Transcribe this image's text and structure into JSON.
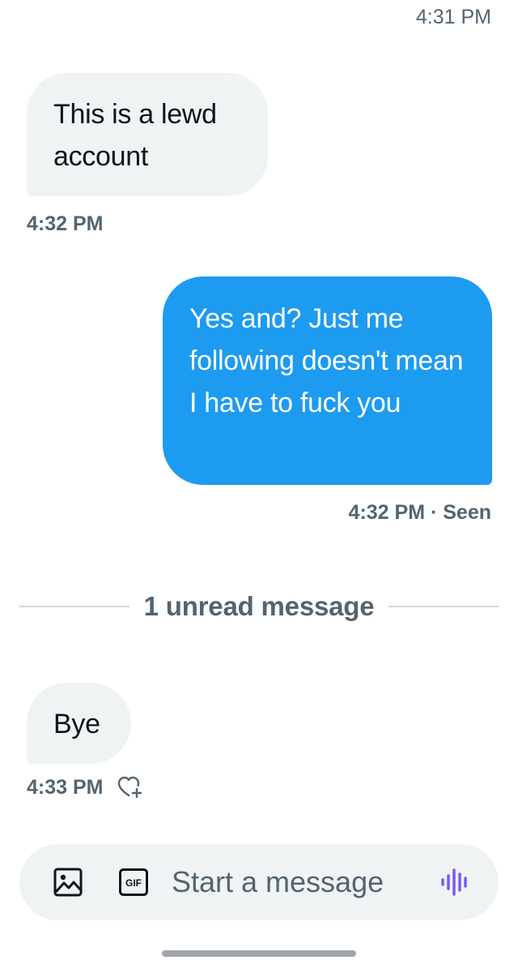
{
  "conversation": {
    "top_timestamp": "4:31 PM",
    "messages": [
      {
        "direction": "incoming",
        "text": "This is a lewd account",
        "meta": "4:32 PM"
      },
      {
        "direction": "outgoing",
        "text": "Yes and? Just me following doesn't mean I have to fuck you",
        "meta": "4:32 PM · Seen"
      },
      {
        "direction": "incoming",
        "text": "Bye",
        "meta": "4:33 PM",
        "reaction_icon": "add-reaction-heart-icon"
      }
    ],
    "unread_divider": "1 unread message"
  },
  "composer": {
    "placeholder": "Start a message",
    "image_icon": "image-icon",
    "gif_icon": "gif-icon",
    "gif_label": "GIF",
    "voice_icon": "voice-message-icon"
  },
  "colors": {
    "accent": "#1d9bf0",
    "incoming_bubble": "#eff3f4",
    "muted_text": "#536471",
    "voice_accent": "#7856ff",
    "divider": "#cfd9de"
  }
}
